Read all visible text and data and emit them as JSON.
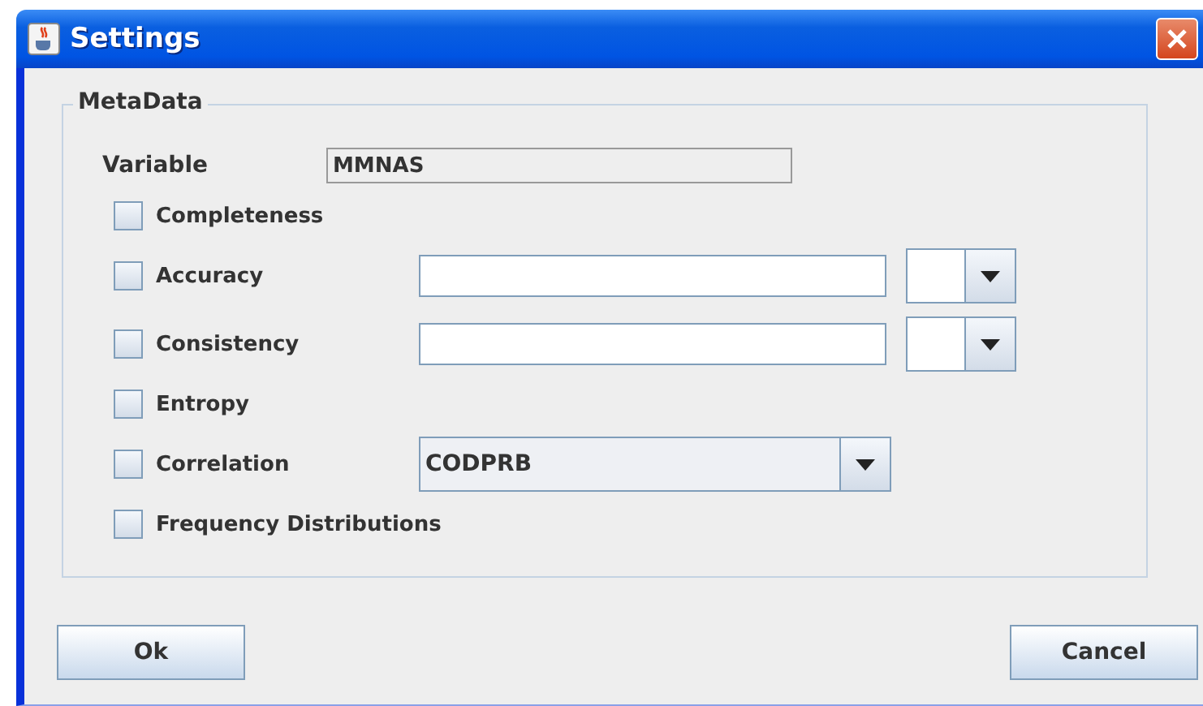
{
  "window": {
    "title": "Settings"
  },
  "group": {
    "title": "MetaData"
  },
  "variable": {
    "label": "Variable",
    "value": "MMNAS"
  },
  "rows": [
    {
      "kind": "plain",
      "label": "Completeness",
      "checked": false
    },
    {
      "kind": "field_dropdown",
      "label": "Accuracy",
      "checked": false
    },
    {
      "kind": "field_dropdown",
      "label": "Consistency",
      "checked": false
    },
    {
      "kind": "plain",
      "label": "Entropy",
      "checked": false
    },
    {
      "kind": "dropdown",
      "label": "Correlation",
      "checked": false,
      "value": "CODPRB"
    },
    {
      "kind": "plain",
      "label": "Frequency Distributions",
      "checked": false
    }
  ],
  "buttons": [
    "Ok",
    "Cancel"
  ]
}
